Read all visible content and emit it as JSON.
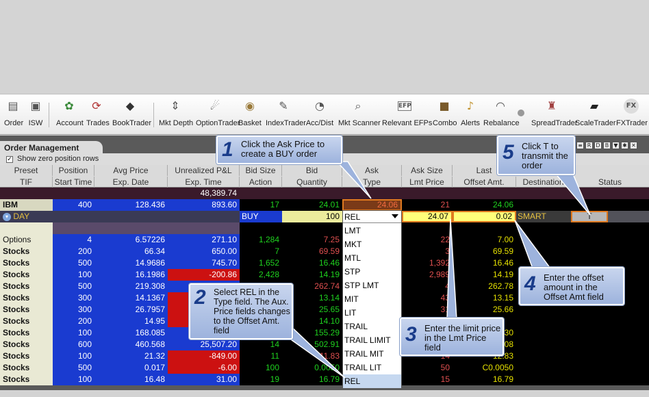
{
  "toolbar": {
    "buttons": [
      {
        "label": "Order",
        "icon": "order-icon"
      },
      {
        "label": "ISW",
        "icon": "isw-icon"
      },
      {
        "label": "Account",
        "icon": "account-icon"
      },
      {
        "label": "Trades",
        "icon": "trades-icon"
      },
      {
        "label": "BookTrader",
        "icon": "booktrader-icon"
      },
      {
        "label": "Mkt Depth",
        "icon": "mkt-depth-icon"
      },
      {
        "label": "OptionTrader",
        "icon": "optiontrader-icon"
      },
      {
        "label": "Basket",
        "icon": "basket-icon"
      },
      {
        "label": "IndexTrader",
        "icon": "indextrader-icon"
      },
      {
        "label": "Acc/Dist",
        "icon": "acc-dist-icon"
      },
      {
        "label": "Mkt Scanner",
        "icon": "mkt-scanner-icon"
      },
      {
        "label": "Relevant EFPs",
        "icon": "efp-icon"
      },
      {
        "label": "Combo",
        "icon": "combo-icon"
      },
      {
        "label": "Alerts",
        "icon": "alerts-icon"
      },
      {
        "label": "Rebalance",
        "icon": "rebalance-icon"
      },
      {
        "label": "SpreadTrader",
        "icon": "spreadtrader-icon"
      },
      {
        "label": "ScaleTrader",
        "icon": "scaletrader-icon"
      },
      {
        "label": "FXTrader",
        "icon": "fxtrader-icon"
      }
    ]
  },
  "panel": {
    "title": "Order Management",
    "show_zero_label": "Show zero position rows",
    "show_zero_checked": "✓",
    "corner_icons": [
      "R",
      "D",
      "B"
    ]
  },
  "columns": {
    "row1": [
      "Preset",
      "Position",
      "Avg Price",
      "Unrealized P&L",
      "Bid Size",
      "Bid",
      "Ask",
      "Ask Size",
      "Last",
      "",
      ""
    ],
    "row2": [
      "TIF",
      "Start Time",
      "Exp. Date",
      "Exp. Time",
      "Action",
      "Quantity",
      "Type",
      "Lmt Price",
      "Offset Amt.",
      "Destination",
      "Status"
    ]
  },
  "total_pnl": "48,389.74",
  "ibm": {
    "symbol": "IBM",
    "position": "400",
    "avg": "128.436",
    "pnl": "893.60",
    "bid_size": "17",
    "bid": "24.01",
    "ask": "24.06",
    "ask_size": "21",
    "last": "24.06"
  },
  "order": {
    "tif": "DAY",
    "action": "BUY",
    "quantity": "100",
    "type": "REL",
    "lmt_price": "24.07",
    "offset": "0.02",
    "destination": "SMART",
    "status": "T"
  },
  "rows": [
    {
      "sym": "Options",
      "pos": "4",
      "avg": "6.57226",
      "pnl": "271.10",
      "neg": false,
      "bsz": "1,284",
      "bid": "7.25",
      "ask": "",
      "asz": "22",
      "lst": "7.00"
    },
    {
      "sym": "Stocks",
      "pos": "200",
      "avg": "66.34",
      "pnl": "650.00",
      "neg": false,
      "bsz": "7",
      "bid": "69.59",
      "ask": "",
      "asz": "3",
      "lst": "69.59"
    },
    {
      "sym": "Stocks",
      "pos": "500",
      "avg": "14.9686",
      "pnl": "745.70",
      "neg": false,
      "bsz": "1,652",
      "bid": "16.46",
      "ask": "",
      "asz": "1,392",
      "lst": "16.46"
    },
    {
      "sym": "Stocks",
      "pos": "100",
      "avg": "16.1986",
      "pnl": "-200.86",
      "neg": true,
      "bsz": "2,428",
      "bid": "14.19",
      "ask": "",
      "asz": "2,989",
      "lst": "14.19"
    },
    {
      "sym": "Stocks",
      "pos": "500",
      "avg": "219.308",
      "pnl": "",
      "neg": false,
      "bsz": "",
      "bid": "262.74",
      "ask": "",
      "asz": "4",
      "lst": "262.78"
    },
    {
      "sym": "Stocks",
      "pos": "300",
      "avg": "14.1367",
      "pnl": "",
      "neg": true,
      "bsz": "",
      "bid": "13.14",
      "ask": "",
      "asz": "43",
      "lst": "13.15"
    },
    {
      "sym": "Stocks",
      "pos": "300",
      "avg": "26.7957",
      "pnl": "",
      "neg": true,
      "bsz": "",
      "bid": "25.65",
      "ask": "",
      "asz": "31",
      "lst": "25.66"
    },
    {
      "sym": "Stocks",
      "pos": "200",
      "avg": "14.95",
      "pnl": "",
      "neg": true,
      "bsz": "",
      "bid": "14.10",
      "ask": "",
      "asz": "",
      "lst": ""
    },
    {
      "sym": "Stocks",
      "pos": "100",
      "avg": "168.085",
      "pnl": "",
      "neg": false,
      "bsz": "",
      "bid": "155.29",
      "ask": "",
      "asz": "",
      "lst": "30"
    },
    {
      "sym": "Stocks",
      "pos": "600",
      "avg": "460.568",
      "pnl": "25,507.20",
      "neg": false,
      "bsz": "14",
      "bid": "502.91",
      "ask": "",
      "asz": "",
      "lst": "08"
    },
    {
      "sym": "Stocks",
      "pos": "100",
      "avg": "21.32",
      "pnl": "-849.00",
      "neg": true,
      "bsz": "11",
      "bid": "11.83",
      "ask": "",
      "asz": "14",
      "lst": "12.83"
    },
    {
      "sym": "Stocks",
      "pos": "500",
      "avg": "0.017",
      "pnl": "-6.00",
      "neg": true,
      "bsz": "100",
      "bid": "0.0050",
      "ask": "",
      "asz": "50",
      "lst": "C0.0050"
    },
    {
      "sym": "Stocks",
      "pos": "100",
      "avg": "16.48",
      "pnl": "31.00",
      "neg": false,
      "bsz": "19",
      "bid": "16.79",
      "ask": "",
      "asz": "15",
      "lst": "16.79"
    }
  ],
  "dropdown": {
    "selected": "REL",
    "options": [
      "LMT",
      "MKT",
      "MTL",
      "STP",
      "STP LMT",
      "MIT",
      "LIT",
      "TRAIL",
      "TRAIL LIMIT",
      "TRAIL MIT",
      "TRAIL LIT",
      "REL"
    ]
  },
  "callouts": [
    {
      "num": "1",
      "text": "Click the Ask Price to create a BUY order"
    },
    {
      "num": "2",
      "text": "Select REL in the Type field. The Aux. Price fields changes to the Offset Amt. field"
    },
    {
      "num": "3",
      "text": "Enter the limit price in the Lmt Price field"
    },
    {
      "num": "4",
      "text": "Enter the offset amount in the Offset Amt field"
    },
    {
      "num": "5",
      "text": "Click T to transmit the order"
    }
  ],
  "colors": {
    "position_blue": "#1a3bd0",
    "negative_red": "#cc1111",
    "bid_green": "#1fd21f",
    "ask_red": "#e05050",
    "last_yellow": "#e5e000",
    "callout_blue": "#9db3dd"
  }
}
